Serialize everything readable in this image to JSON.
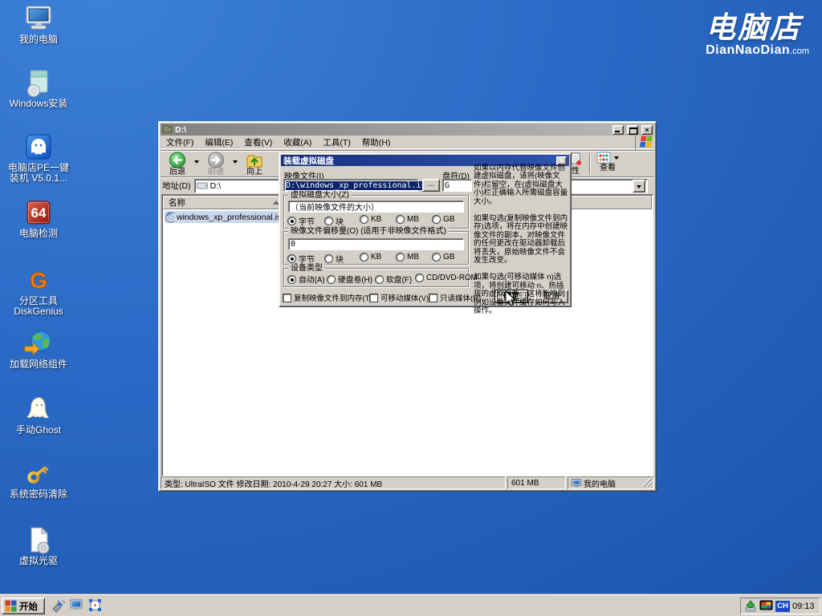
{
  "colors": {
    "desktop_blue": "#2a6ac6",
    "chrome_gray": "#d4d0c8",
    "dialog_title_start": "#17307e",
    "dialog_title_end": "#2f55ae",
    "selection_navy": "#0a246a",
    "inactive_selection": "#c9d7ec"
  },
  "brand": {
    "name": "电脑店",
    "domain": "DianNaoDian",
    "suffix": ".com"
  },
  "desktop_icons": [
    {
      "name": "my-computer",
      "label": "我的电脑"
    },
    {
      "name": "windows-install",
      "label": "Windows安装"
    },
    {
      "name": "pe-one-key-install",
      "label": "电脑店PE一键\n装机 V5.0.1..."
    },
    {
      "name": "pc-check",
      "label": "电脑检测",
      "badge": "64"
    },
    {
      "name": "diskgenius",
      "label": "分区工具\nDiskGenius",
      "glyph": "G"
    },
    {
      "name": "load-network",
      "label": "加载网络组件"
    },
    {
      "name": "manual-ghost",
      "label": "手动Ghost"
    },
    {
      "name": "password-clear",
      "label": "系统密码清除"
    },
    {
      "name": "virtual-cdrom",
      "label": "虚拟光驱"
    }
  ],
  "explorer": {
    "title": "D:\\",
    "menus": [
      "文件(F)",
      "编辑(E)",
      "查看(V)",
      "收藏(A)",
      "工具(T)",
      "帮助(H)"
    ],
    "toolbar": {
      "back": "后退",
      "forward": "前进",
      "up": "向上",
      "views": "查看",
      "props_partial": "性"
    },
    "address": {
      "label": "地址(D)",
      "value": "D:\\"
    },
    "list": {
      "name_header": "名称",
      "file": "windows_xp_professional.iso"
    },
    "status": {
      "info": "类型: UltraISO 文件 修改日期: 2010-4-29 20:27 大小: 601 MB",
      "size": "601 MB",
      "zone": "我的电脑"
    }
  },
  "dialog": {
    "title": "装载虚拟磁盘",
    "image_file_label": "映像文件(I)",
    "image_file_value": "D:\\windows_xp_professional.iso",
    "browse": "...",
    "drive_label": "盘符(D)",
    "drive_value": "G",
    "size_group": "虚拟磁盘大小(Z)",
    "size_value": "（当前映像文件的大小）",
    "offset_group": "映像文件偏移量(O) (适用于非映像文件格式)",
    "offset_value": "0",
    "units": [
      "字节",
      "块",
      "KB",
      "MB",
      "GB"
    ],
    "device_group": "设备类型",
    "devices": [
      "自动(A)",
      "硬盘卷(H)",
      "软盘(F)",
      "CD/DVD-ROM"
    ],
    "checkboxes": [
      "复制映像文件到内存(T)",
      "可移动媒体(V)",
      "只读媒体(R)"
    ],
    "ok": "确定",
    "cancel": "取消",
    "help": [
      "如果以内存代替映像文件创建虚拟磁盘，请将(映像文件)栏留空，在(虚拟磁盘大小)栏正确输入所需磁盘容量大小。",
      "如果勾选(复制映像文件到内存)选项，将在内存中创建映像文件的副本，对映像文件的任何更改在驱动器卸载后将丢失，原始映像文件不会发生改变。",
      "如果勾选(可移动媒体 n)选项，将创建可移动 n、热插拔的虚拟设备。这将影响到例如设备文件缓存如何写入操作。"
    ]
  },
  "taskbar": {
    "start_label": "开始",
    "lang": "CH",
    "time": "09:13"
  }
}
